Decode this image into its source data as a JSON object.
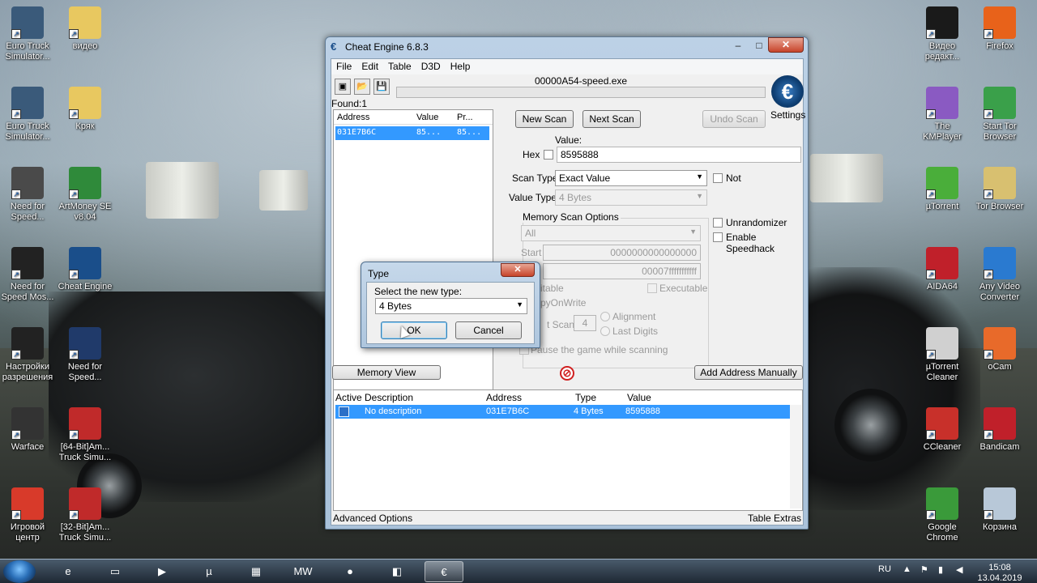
{
  "desktop": {
    "left_icons": [
      {
        "label": "Euro Truck Simulator...",
        "icon": "truck-icon",
        "color": "#3a5a7a"
      },
      {
        "label": "видео",
        "icon": "folder-icon",
        "color": "#e8c860"
      },
      {
        "label": "Euro Truck Simulator...",
        "icon": "truck-icon",
        "color": "#3a5a7a"
      },
      {
        "label": "Кряк",
        "icon": "folder-icon",
        "color": "#e8c860"
      },
      {
        "label": "Need for Speed...",
        "icon": "nfs-icon",
        "color": "#4a4a4a"
      },
      {
        "label": "ArtMoney SE v8.04",
        "icon": "money-icon",
        "color": "#2f8a3a"
      },
      {
        "label": "Need for Speed Mos...",
        "icon": "nfs-mw-icon",
        "color": "#222"
      },
      {
        "label": "Cheat Engine",
        "icon": "cheat-engine-icon",
        "color": "#1a4e8a"
      },
      {
        "label": "Настройки разрешения",
        "icon": "nfs-mw-icon",
        "color": "#222"
      },
      {
        "label": "Need for Speed...",
        "icon": "car-icon",
        "color": "#203a6a"
      },
      {
        "label": "Warface",
        "icon": "warface-icon",
        "color": "#333"
      },
      {
        "label": "[64-Bit]Am... Truck Simu...",
        "icon": "truck-red-icon",
        "color": "#c02a2a"
      },
      {
        "label": "Игровой центр",
        "icon": "game-center-icon",
        "color": "#d83a2a"
      },
      {
        "label": "[32-Bit]Am... Truck Simu...",
        "icon": "truck-red-icon",
        "color": "#c02a2a"
      }
    ],
    "right_icons": [
      {
        "label": "Видео редакт...",
        "icon": "video-editor-icon",
        "color": "#1a1a1a"
      },
      {
        "label": "Firefox",
        "icon": "firefox-icon",
        "color": "#e8621a"
      },
      {
        "label": "The KMPlayer",
        "icon": "kmplayer-icon",
        "color": "#8a5ac2"
      },
      {
        "label": "Start Tor Browser",
        "icon": "globe-icon",
        "color": "#3aa04a"
      },
      {
        "label": "µTorrent",
        "icon": "utorrent-icon",
        "color": "#4aae3a"
      },
      {
        "label": "Tor Browser",
        "icon": "folder-icon",
        "color": "#d8c070"
      },
      {
        "label": "AIDA64",
        "icon": "aida64-icon",
        "color": "#c0202a"
      },
      {
        "label": "Any Video Converter",
        "icon": "converter-icon",
        "color": "#2a7ad0"
      },
      {
        "label": "µTorrent Cleaner",
        "icon": "cleaner-icon",
        "color": "#d0d0d0"
      },
      {
        "label": "oCam",
        "icon": "ocam-icon",
        "color": "#e86a2a"
      },
      {
        "label": "CCleaner",
        "icon": "ccleaner-icon",
        "color": "#c8302a"
      },
      {
        "label": "Bandicam",
        "icon": "bandicam-icon",
        "color": "#c0202a"
      },
      {
        "label": "Google Chrome",
        "icon": "chrome-icon",
        "color": "#3a9a3a"
      },
      {
        "label": "Корзина",
        "icon": "recycle-bin-icon",
        "color": "#b8c8d8"
      }
    ]
  },
  "window": {
    "title": "Cheat Engine 6.8.3",
    "controls": {
      "minimize": "–",
      "maximize": "□",
      "close": "✕"
    },
    "menu": [
      "File",
      "Edit",
      "Table",
      "D3D",
      "Help"
    ],
    "process": "00000A54-speed.exe",
    "found": "Found:1",
    "settings": "Settings",
    "logo": "€",
    "results": {
      "headers": [
        "Address",
        "Value",
        "Pr..."
      ],
      "rows": [
        {
          "address": "031E7B6C",
          "value": "85...",
          "previous": "85..."
        }
      ]
    },
    "scan": {
      "new_scan": "New Scan",
      "next_scan": "Next Scan",
      "undo_scan": "Undo Scan",
      "value_label": "Value:",
      "hex_label": "Hex",
      "value": "8595888",
      "scan_type_label": "Scan Type",
      "scan_type": "Exact Value",
      "not_label": "Not",
      "value_type_label": "Value Type",
      "value_type": "4 Bytes",
      "memory_options_label": "Memory Scan Options",
      "memory_region": "All",
      "start_label": "Start",
      "start_value": "0000000000000000",
      "stop_value": "00007fffffffffff",
      "writable_label": "itable",
      "executable_label": "Executable",
      "cow_label": "pyOnWrite",
      "fast_scan_label": "t Scan",
      "fast_scan_value": "4",
      "alignment_label": "Alignment",
      "last_digits_label": "Last Digits",
      "pause_label": "Pause the game while scanning",
      "unrandomizer_label": "Unrandomizer",
      "speedhack_label": "Enable Speedhack"
    },
    "memory_view": "Memory View",
    "add_address": "Add Address Manually",
    "address_list": {
      "headers": [
        "Active",
        "Description",
        "Address",
        "Type",
        "Value"
      ],
      "rows": [
        {
          "description": "No description",
          "address": "031E7B6C",
          "type": "4 Bytes",
          "value": "8595888"
        }
      ]
    },
    "advanced_options": "Advanced Options",
    "table_extras": "Table Extras"
  },
  "dialog": {
    "title": "Type",
    "close": "✕",
    "prompt": "Select the new type:",
    "selected_type": "4 Bytes",
    "ok": "OK",
    "cancel": "Cancel"
  },
  "taskbar": {
    "apps": [
      {
        "icon": "ie-icon",
        "glyph": "e"
      },
      {
        "icon": "explorer-icon",
        "glyph": "▭"
      },
      {
        "icon": "media-player-icon",
        "glyph": "▶"
      },
      {
        "icon": "utorrent-icon",
        "glyph": "µ"
      },
      {
        "icon": "calculator-icon",
        "glyph": "▦"
      },
      {
        "icon": "nfs-mw-icon",
        "glyph": "MW"
      },
      {
        "icon": "recorder-icon",
        "glyph": "●"
      },
      {
        "icon": "ocam-icon",
        "glyph": "◧"
      },
      {
        "icon": "cheat-engine-icon",
        "glyph": "€"
      }
    ],
    "language": "RU",
    "time": "15:08",
    "date": "13.04.2019"
  }
}
